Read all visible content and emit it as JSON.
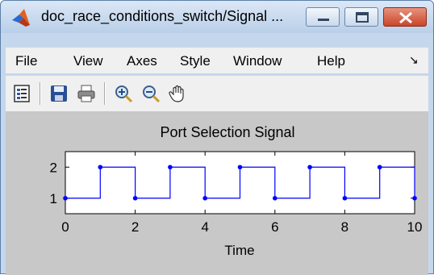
{
  "window": {
    "title": "doc_race_conditions_switch/Signal ...",
    "menu": [
      "File",
      "View",
      "Axes",
      "Style",
      "Window",
      "Help"
    ],
    "menu_arrow": "↘"
  },
  "toolbar": {
    "icons": [
      "properties-icon",
      "save-icon",
      "print-icon",
      "zoom-in-icon",
      "zoom-out-icon",
      "pan-hand-icon"
    ]
  },
  "colors": {
    "signal": "#0000ff",
    "plot_bg": "#ffffff",
    "figure_bg": "#c8c8c8"
  },
  "chart_data": {
    "type": "line",
    "step": true,
    "title": "Port Selection Signal",
    "xlabel": "Time",
    "ylabel": "",
    "xlim": [
      0,
      10
    ],
    "ylim": [
      0.5,
      2.5
    ],
    "x_ticks": [
      "0",
      "2",
      "4",
      "6",
      "8",
      "10"
    ],
    "y_ticks": [
      "1",
      "2"
    ],
    "series": [
      {
        "x": [
          0,
          1,
          2,
          3,
          4,
          5,
          6,
          7,
          8,
          9,
          10
        ],
        "values": [
          1,
          2,
          1,
          2,
          1,
          2,
          1,
          2,
          1,
          2,
          1
        ]
      }
    ]
  }
}
